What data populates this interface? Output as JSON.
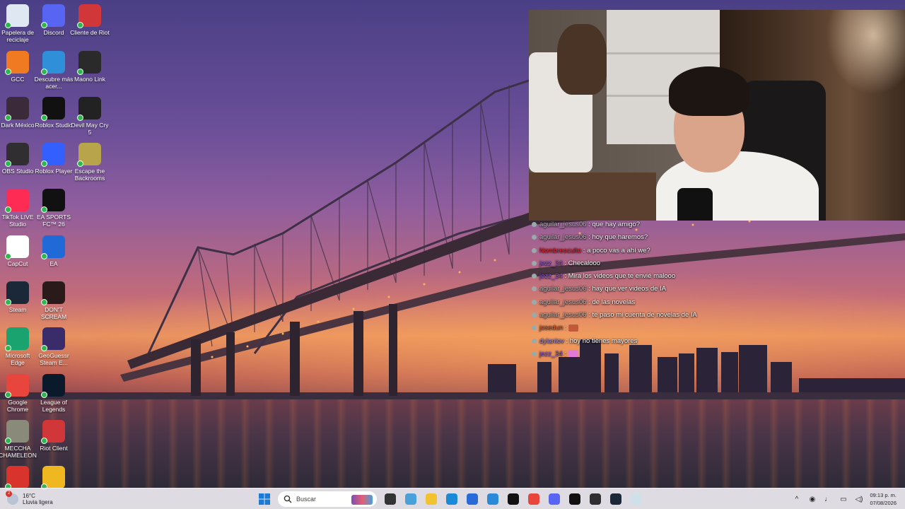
{
  "desktop_icons": [
    {
      "label": "Papelera de reciclaje",
      "icon": "recycle-bin-icon",
      "color": "#dfe8f2"
    },
    {
      "label": "Discord",
      "icon": "discord-icon",
      "color": "#5865f2"
    },
    {
      "label": "Cliente de Riot",
      "icon": "riot-client-icon",
      "color": "#d13639"
    },
    {
      "label": "GCC",
      "icon": "gcc-icon",
      "color": "#f07a22"
    },
    {
      "label": "Descubre más acer...",
      "icon": "spotlight-icon",
      "color": "#2f8fd8"
    },
    {
      "label": "Maono Link",
      "icon": "maono-link-icon",
      "color": "#2a2a2a"
    },
    {
      "label": "Dark México",
      "icon": "dark-mexico-icon",
      "color": "#3a2a3a"
    },
    {
      "label": "Roblox Studio",
      "icon": "roblox-studio-icon",
      "color": "#111111"
    },
    {
      "label": "Devil May Cry 5",
      "icon": "devil-may-cry-icon",
      "color": "#222222"
    },
    {
      "label": "OBS Studio",
      "icon": "obs-icon",
      "color": "#302e31"
    },
    {
      "label": "Roblox Player",
      "icon": "roblox-player-icon",
      "color": "#335fff"
    },
    {
      "label": "Escape the Backrooms",
      "icon": "escape-backrooms-icon",
      "color": "#b8a44a"
    },
    {
      "label": "TikTok LIVE Studio",
      "icon": "tiktok-live-icon",
      "color": "#fe2c55"
    },
    {
      "label": "EA SPORTS FC™ 26",
      "icon": "ea-fc-icon",
      "color": "#111111"
    },
    {
      "label": "CapCut",
      "icon": "capcut-icon",
      "color": "#ffffff"
    },
    {
      "label": "EA",
      "icon": "ea-icon",
      "color": "#1f6ad6"
    },
    {
      "label": "Steam",
      "icon": "steam-icon",
      "color": "#1b2838"
    },
    {
      "label": "DON'T SCREAM",
      "icon": "dont-scream-icon",
      "color": "#2a1a1a"
    },
    {
      "label": "Microsoft Edge",
      "icon": "edge-icon",
      "color": "#1aa36f"
    },
    {
      "label": "GeoGuessr Steam E...",
      "icon": "geoguessr-icon",
      "color": "#3a2c6a"
    },
    {
      "label": "Google Chrome",
      "icon": "chrome-icon",
      "color": "#e8453c"
    },
    {
      "label": "League of Legends",
      "icon": "league-icon",
      "color": "#0a1a2a"
    },
    {
      "label": "MECCHA CHAMELEON",
      "icon": "meccha-chameleon-icon",
      "color": "#8a8a7a"
    },
    {
      "label": "Riot Client",
      "icon": "riot-client-icon",
      "color": "#d13639"
    },
    {
      "label": "",
      "icon": "ca-app-icon",
      "color": "#d8342c"
    },
    {
      "label": "",
      "icon": "t-app-icon",
      "color": "#f0b820"
    }
  ],
  "chat": {
    "messages": [
      {
        "user": "aguilar_jesus06",
        "text": "que hay amigo?",
        "color": "#b8b8b8"
      },
      {
        "user": "aguilar_jesus06",
        "text": "hoy que haremos?",
        "color": "#b8b8b8"
      },
      {
        "user": "Nombreoculto",
        "text": "a poco vas a ahí we?",
        "color": "#e0222a"
      },
      {
        "user": "jezz_34",
        "text": "Checalooo",
        "color": "#8a5ac8"
      },
      {
        "user": "jezz_34",
        "text": "Mira los videos que te envié malooo",
        "color": "#8a5ac8"
      },
      {
        "user": "aguilar_jesus06",
        "text": "hay que ver videos de IA",
        "color": "#b8b8b8"
      },
      {
        "user": "aguilar_jesus06",
        "text": "de las novelas",
        "color": "#b8b8b8"
      },
      {
        "user": "aguilar_jesus06",
        "text": "te paso mi cuenta de novelas de IA",
        "color": "#b8b8b8"
      },
      {
        "user": "josedun",
        "text": "",
        "color": "#e05a2a"
      },
      {
        "user": "dylanlov",
        "text": "hoy no tienes mayores",
        "color": "#9a8ad8"
      },
      {
        "user": "jezz_34",
        "text": "",
        "color": "#8a5ac8"
      }
    ]
  },
  "taskbar": {
    "weather_temp": "16°C",
    "weather_desc": "Lluvia ligera",
    "weather_badge": "2",
    "search_placeholder": "Buscar",
    "time": "09:13 p. m.",
    "date": "07/08/2026",
    "apps": [
      {
        "icon": "task-view-icon",
        "color": "#333333"
      },
      {
        "icon": "copilot-icon",
        "color": "#4aa0d8"
      },
      {
        "icon": "file-explorer-icon",
        "color": "#f2c230"
      },
      {
        "icon": "edge-icon",
        "color": "#1a8ad8"
      },
      {
        "icon": "store-icon",
        "color": "#2a6ad8"
      },
      {
        "icon": "maps-icon",
        "color": "#2a8ad8"
      },
      {
        "icon": "tiktok-icon",
        "color": "#111111"
      },
      {
        "icon": "chrome-icon",
        "color": "#e8453c"
      },
      {
        "icon": "discord-icon",
        "color": "#5865f2"
      },
      {
        "icon": "capcut-icon",
        "color": "#111111"
      },
      {
        "icon": "obs-icon",
        "color": "#302e31"
      },
      {
        "icon": "steam-icon",
        "color": "#1b2838"
      },
      {
        "icon": "notepad-icon",
        "color": "#cfe0e8"
      }
    ],
    "tray": [
      {
        "icon": "chevron-up-icon",
        "glyph": "^"
      },
      {
        "icon": "teams-icon",
        "glyph": "◉"
      },
      {
        "icon": "microphone-icon",
        "glyph": "♩"
      },
      {
        "icon": "monitor-icon",
        "glyph": "▭"
      },
      {
        "icon": "volume-icon",
        "glyph": "◁)"
      }
    ]
  }
}
